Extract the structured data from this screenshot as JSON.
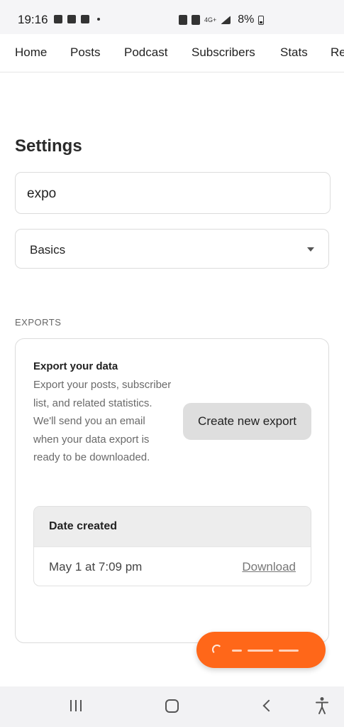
{
  "status_bar": {
    "time": "19:16",
    "battery": "8%",
    "network": "4G+"
  },
  "nav": {
    "tabs": [
      "Home",
      "Posts",
      "Podcast",
      "Subscribers",
      "Stats",
      "Re"
    ]
  },
  "settings": {
    "title": "Settings",
    "search_value": "expo",
    "section_select": "Basics"
  },
  "exports": {
    "section_label": "EXPORTS",
    "card_title": "Export your data",
    "card_description": "Export your posts, subscriber list, and related statistics. We'll send you an email when your data export is ready to be downloaded.",
    "create_button": "Create new export",
    "table": {
      "header": "Date created",
      "rows": [
        {
          "date": "May 1 at 7:09 pm",
          "action": "Download"
        }
      ]
    }
  },
  "colors": {
    "accent": "#ff6719",
    "button_gray": "#dedede",
    "table_header": "#ededed"
  }
}
